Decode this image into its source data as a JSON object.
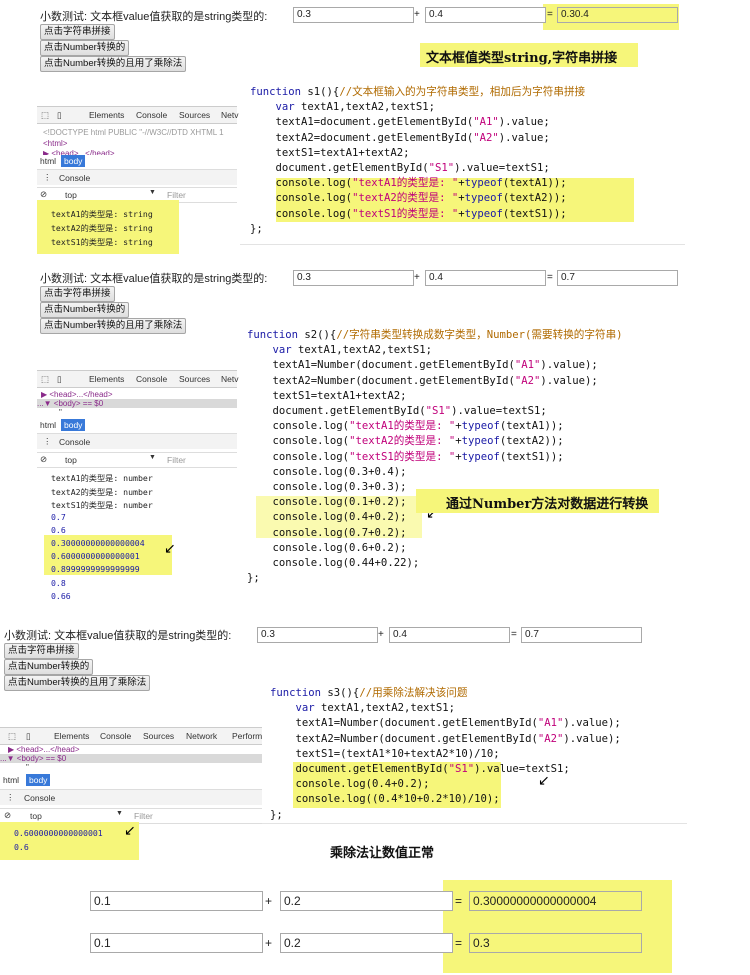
{
  "section1": {
    "label": "小数测试:  文本框value值获取的是string类型的:",
    "a": "0.3",
    "plus": "+",
    "b": "0.4",
    "eq": "=",
    "result": "0.30.4",
    "buttons": [
      "点击字符串拼接",
      "点击Number转换的",
      "点击Number转换的且用了乘除法"
    ],
    "caption": "文本框值类型string,字符串拼接",
    "code": [
      "function s1(){//文本框输入的为字符串类型，相加后为字符串拼接",
      "    var textA1,textA2,textS1;",
      "    textA1=document.getElementById(\"A1\").value;",
      "    textA2=document.getElementById(\"A2\").value;",
      "    textS1=textA1+textA2;",
      "    document.getElementById(\"S1\").value=textS1;",
      "    console.log(\"textA1的类型是: \"+typeof(textA1));",
      "    console.log(\"textA2的类型是: \"+typeof(textA2));",
      "    console.log(\"textS1的类型是: \"+typeof(textS1));",
      "};"
    ],
    "devtools": {
      "tabs": [
        "Elements",
        "Console",
        "Sources",
        "Netv"
      ],
      "doc_line": "<!DOCTYPE html PUBLIC \"-//W3C//DTD XHTML 1",
      "html_line": "<html>",
      "head_line": "▶ <head>...</head>",
      "mini_tabs": [
        "html",
        "body"
      ],
      "console_label": "Console",
      "context": "top",
      "filter": "Filter",
      "logs": [
        "textA1的类型是: string",
        "textA2的类型是: string",
        "textS1的类型是: string"
      ]
    }
  },
  "section2": {
    "label": "小数测试:  文本框value值获取的是string类型的:",
    "a": "0.3",
    "plus": "+",
    "b": "0.4",
    "eq": "=",
    "result": "0.7",
    "buttons": [
      "点击字符串拼接",
      "点击Number转换的",
      "点击Number转换的且用了乘除法"
    ],
    "caption": "通过Number方法对数据进行转换",
    "code": [
      "function s2(){//字符串类型转换成数字类型，Number(需要转换的字符串)",
      "    var textA1,textA2,textS1;",
      "    textA1=Number(document.getElementById(\"A1\").value);",
      "    textA2=Number(document.getElementById(\"A2\").value);",
      "    textS1=textA1+textA2;",
      "    document.getElementById(\"S1\").value=textS1;",
      "    console.log(\"textA1的类型是: \"+typeof(textA1));",
      "    console.log(\"textA2的类型是: \"+typeof(textA2));",
      "    console.log(\"textS1的类型是: \"+typeof(textS1));",
      "    console.log(0.3+0.4);",
      "    console.log(0.3+0.3);",
      "    console.log(0.1+0.2);",
      "    console.log(0.4+0.2);",
      "    console.log(0.7+0.2);",
      "    console.log(0.6+0.2);",
      "    console.log(0.44+0.22);",
      "};"
    ],
    "devtools": {
      "tabs": [
        "Elements",
        "Console",
        "Sources",
        "Netv"
      ],
      "head_line": "▶ <head>...</head>",
      "body_line": "...▼ <body> == $0",
      "quote_line": "\"",
      "mini_tabs": [
        "html",
        "body"
      ],
      "console_label": "Console",
      "context": "top",
      "filter": "Filter",
      "logs": [
        "textA1的类型是: number",
        "textA2的类型是: number",
        "textS1的类型是: number"
      ],
      "nums": [
        "0.7",
        "0.6",
        "0.30000000000000004",
        "0.6000000000000001",
        "0.8999999999999999",
        "0.8",
        "0.66"
      ]
    }
  },
  "section3": {
    "label": "小数测试:  文本框value值获取的是string类型的:",
    "a": "0.3",
    "plus": "+",
    "b": "0.4",
    "eq": "=",
    "result": "0.7",
    "buttons": [
      "点击字符串拼接",
      "点击Number转换的",
      "点击Number转换的且用了乘除法"
    ],
    "code": [
      "function s3(){//用乘除法解决该问题",
      "    var textA1,textA2,textS1;",
      "    textA1=Number(document.getElementById(\"A1\").value);",
      "    textA2=Number(document.getElementById(\"A2\").value);",
      "    textS1=(textA1*10+textA2*10)/10;",
      "    document.getElementById(\"S1\").value=textS1;",
      "    console.log(0.4+0.2);",
      "    console.log((0.4*10+0.2*10)/10);",
      "};"
    ],
    "devtools": {
      "tabs": [
        "Elements",
        "Console",
        "Sources",
        "Network",
        "Perform"
      ],
      "head_line": "▶ <head>...</head>",
      "body_line": "...▼ <body> == $0",
      "quote_line": "\"",
      "mini_tabs": [
        "html",
        "body"
      ],
      "console_label": "Console",
      "context": "top",
      "filter": "Filter",
      "nums": [
        "0.6000000000000001",
        "0.6"
      ]
    }
  },
  "caption4": "乘除法让数值正常",
  "bottom": [
    {
      "a": "0.1",
      "plus": "+",
      "b": "0.2",
      "eq": "=",
      "result": "0.30000000000000004"
    },
    {
      "a": "0.1",
      "plus": "+",
      "b": "0.2",
      "eq": "=",
      "result": "0.3"
    }
  ],
  "colors": {
    "highlight": "#f6f67a",
    "code_keyword": "#000080",
    "code_string": "#c0007a",
    "devtools_active": "#3879d9"
  }
}
